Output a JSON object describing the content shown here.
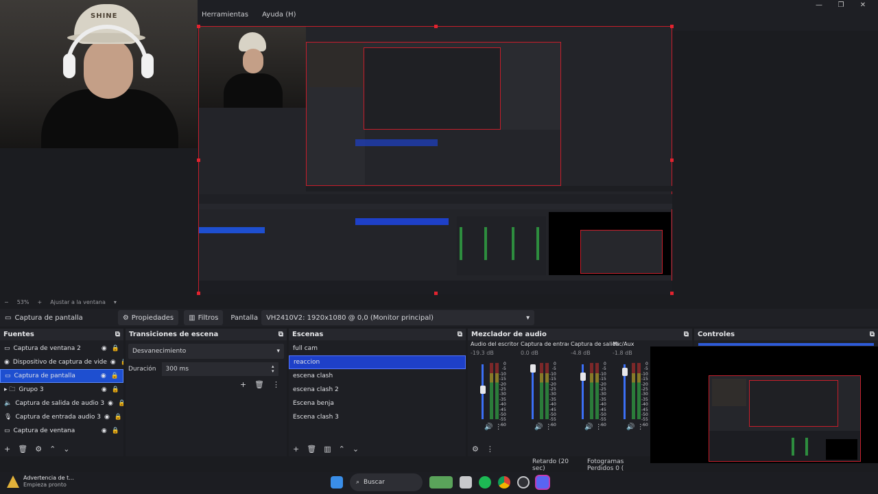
{
  "menu": {
    "items": [
      "Herramientas",
      "Ayuda (H)"
    ]
  },
  "window_controls": {
    "minimize": "—",
    "maximize": "❐",
    "close": "✕"
  },
  "webcam": {
    "cap_text": "SHINE"
  },
  "preview_bar": {
    "minus": "−",
    "zoom": "53%",
    "plus": "+",
    "fit": "Ajustar a la ventana"
  },
  "prop_bar": {
    "source_name": "Captura de pantalla",
    "properties": "Propiedades",
    "filters": "Filtros",
    "display_label": "Pantalla",
    "display_value": "VH2410V2: 1920x1080 @ 0,0 (Monitor principal)"
  },
  "fuentes": {
    "title": "Fuentes",
    "items": [
      {
        "label": "Captura de ventana 2",
        "icon": "window-icon",
        "selected": false
      },
      {
        "label": "Dispositivo de captura de vide",
        "icon": "camera-icon",
        "selected": false
      },
      {
        "label": "Captura de pantalla",
        "icon": "monitor-icon",
        "selected": true
      },
      {
        "label": "Grupo 3",
        "icon": "folder-icon",
        "selected": false
      },
      {
        "label": "Captura de salida de audio 3",
        "icon": "speaker-icon",
        "selected": false
      },
      {
        "label": "Captura de entrada audio 3",
        "icon": "mic-icon",
        "selected": false
      },
      {
        "label": "Captura de ventana",
        "icon": "window-icon",
        "selected": false
      }
    ]
  },
  "transiciones": {
    "title": "Transiciones de escena",
    "transition": "Desvanecimiento",
    "duration_label": "Duración",
    "duration_value": "300 ms"
  },
  "escenas": {
    "title": "Escenas",
    "items": [
      {
        "label": "full cam",
        "selected": false
      },
      {
        "label": "reaccion",
        "selected": true
      },
      {
        "label": "escena clash",
        "selected": false
      },
      {
        "label": "escena clash 2",
        "selected": false
      },
      {
        "label": "Escena benja",
        "selected": false
      },
      {
        "label": "Escena clash 3",
        "selected": false
      }
    ]
  },
  "mezclador": {
    "title": "Mezclador de audio",
    "channels": [
      {
        "name": "Audio del escritorio",
        "db": "-19.3 dB",
        "level": 0.55
      },
      {
        "name": "Captura de entrada",
        "db": "0.0 dB",
        "level": 1.0
      },
      {
        "name": "Captura de salida c",
        "db": "-4.8 dB",
        "level": 0.82
      },
      {
        "name": "Mic/Aux",
        "db": "-1.8 dB",
        "level": 0.92
      }
    ],
    "scale": [
      "0",
      "-5",
      "-10",
      "-15",
      "-20",
      "-25",
      "-30",
      "-35",
      "-40",
      "-45",
      "-50",
      "-55",
      "-60"
    ]
  },
  "controles": {
    "title": "Controles"
  },
  "status": {
    "delay": "Retardo (20 sec)",
    "dropped": "Fotogramas Perdidos 0 ("
  },
  "taskbar": {
    "notif_title": "Advertencia de t...",
    "notif_sub": "Empieza pronto",
    "search": "Buscar"
  },
  "colors": {
    "accent": "#1e4fd0",
    "selection_border": "#c81e2b",
    "meter_green": "#2d8d3e"
  }
}
